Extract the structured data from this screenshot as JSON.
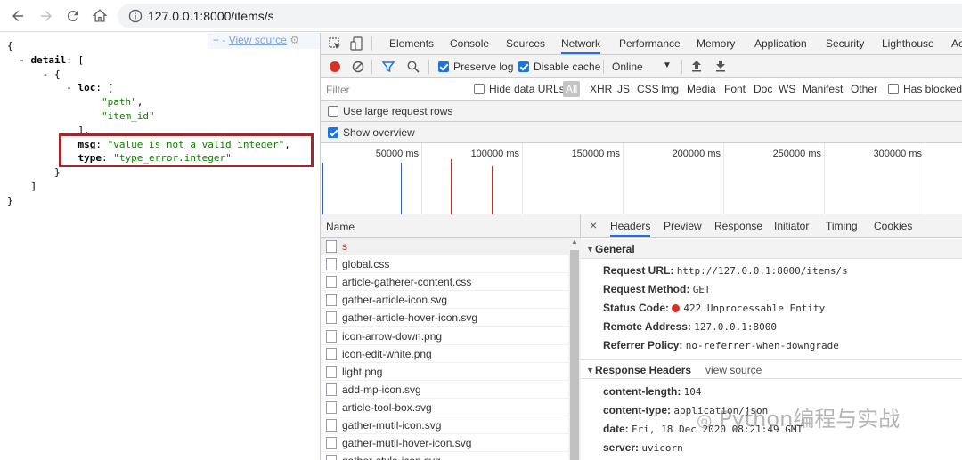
{
  "browser": {
    "url": "127.0.0.1:8000/items/s"
  },
  "json_view": {
    "view_links_prefix": "+ -",
    "view_source": "View source",
    "lines": [
      {
        "indent": "",
        "parts": [
          [
            "p",
            "{"
          ]
        ]
      },
      {
        "indent": "  ",
        "parts": [
          [
            "p",
            "- "
          ],
          [
            "k",
            "detail"
          ],
          [
            "p",
            ": ["
          ]
        ]
      },
      {
        "indent": "      ",
        "parts": [
          [
            "p",
            "- {"
          ]
        ]
      },
      {
        "indent": "          ",
        "parts": [
          [
            "p",
            "- "
          ],
          [
            "k",
            "loc"
          ],
          [
            "p",
            ": ["
          ]
        ]
      },
      {
        "indent": "                ",
        "parts": [
          [
            "s",
            "\"path\""
          ],
          [
            "p",
            ","
          ]
        ]
      },
      {
        "indent": "                ",
        "parts": [
          [
            "s",
            "\"item_id\""
          ]
        ]
      },
      {
        "indent": "            ",
        "parts": [
          [
            "p",
            "],"
          ]
        ]
      },
      {
        "indent": "            ",
        "parts": [
          [
            "k",
            "msg"
          ],
          [
            "p",
            ": "
          ],
          [
            "s",
            "\"value is not a valid integer\""
          ],
          [
            "p",
            ","
          ]
        ]
      },
      {
        "indent": "            ",
        "parts": [
          [
            "k",
            "type"
          ],
          [
            "p",
            ": "
          ],
          [
            "s",
            "\"type_error.integer\""
          ]
        ]
      },
      {
        "indent": "        ",
        "parts": [
          [
            "p",
            "}"
          ]
        ]
      },
      {
        "indent": "    ",
        "parts": [
          [
            "p",
            "]"
          ]
        ]
      },
      {
        "indent": "",
        "parts": [
          [
            "p",
            "}"
          ]
        ]
      }
    ]
  },
  "devtools": {
    "tabs": [
      "Elements",
      "Console",
      "Sources",
      "Network",
      "Performance",
      "Memory",
      "Application",
      "Security",
      "Lighthouse",
      "Ac"
    ],
    "active_tab": "Network",
    "toolbar": {
      "preserve_log": "Preserve log",
      "disable_cache": "Disable cache",
      "throttle": "Online"
    },
    "filter": {
      "placeholder": "Filter",
      "hide_data_urls": "Hide data URLs",
      "all": "All",
      "types": [
        "XHR",
        "JS",
        "CSS",
        "Img",
        "Media",
        "Font",
        "Doc",
        "WS",
        "Manifest",
        "Other"
      ],
      "has_blocked": "Has blocked"
    },
    "options": {
      "large_rows": "Use large request rows",
      "show_overview": "Show overview"
    },
    "overview_ticks": [
      "50000 ms",
      "100000 ms",
      "150000 ms",
      "200000 ms",
      "250000 ms",
      "300000 ms"
    ],
    "name_header": "Name",
    "requests": [
      "s",
      "global.css",
      "article-gatherer-content.css",
      "gather-article-icon.svg",
      "gather-article-hover-icon.svg",
      "icon-arrow-down.png",
      "icon-edit-white.png",
      "light.png",
      "add-mp-icon.svg",
      "article-tool-box.svg",
      "gather-mutil-icon.svg",
      "gather-mutil-hover-icon.svg",
      "gather-style-icon.svg"
    ],
    "details_tabs": [
      "Headers",
      "Preview",
      "Response",
      "Initiator",
      "Timing",
      "Cookies"
    ],
    "general": {
      "title": "General",
      "request_url_k": "Request URL:",
      "request_url_v": "http://127.0.0.1:8000/items/s",
      "method_k": "Request Method:",
      "method_v": "GET",
      "status_k": "Status Code:",
      "status_v": "422 Unprocessable Entity",
      "remote_k": "Remote Address:",
      "remote_v": "127.0.0.1:8000",
      "referrer_k": "Referrer Policy:",
      "referrer_v": "no-referrer-when-downgrade"
    },
    "response_headers": {
      "title": "Response Headers",
      "view_source": "view source",
      "content_length_k": "content-length:",
      "content_length_v": "104",
      "content_type_k": "content-type:",
      "content_type_v": "application/json",
      "date_k": "date:",
      "date_v": "Fri, 18 Dec 2020 08:21:49 GMT",
      "server_k": "server:",
      "server_v": "uvicorn"
    }
  },
  "watermark": "Python编程与实战"
}
